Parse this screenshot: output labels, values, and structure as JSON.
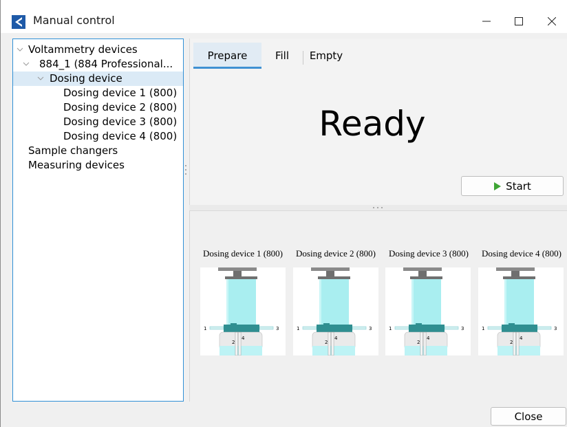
{
  "window": {
    "title": "Manual control",
    "icon": "app-logo-icon",
    "controls": [
      "minimize-icon",
      "maximize-icon",
      "close-icon"
    ]
  },
  "tree": {
    "root": {
      "label": "Voltammetry devices",
      "expanded": true
    },
    "instrument": {
      "label": "884_1 (884 Professional...",
      "expanded": true
    },
    "group": {
      "label": "Dosing device",
      "expanded": true,
      "selected": true
    },
    "devices": [
      "Dosing device 1 (800)",
      "Dosing device 2 (800)",
      "Dosing device 3 (800)",
      "Dosing device 4 (800)"
    ],
    "other": [
      "Sample changers",
      "Measuring devices"
    ]
  },
  "tabs": [
    {
      "label": "Prepare",
      "active": true
    },
    {
      "label": "Fill",
      "active": false
    },
    {
      "label": "Empty",
      "active": false
    }
  ],
  "status": "Ready",
  "start_button": {
    "label": "Start",
    "icon": "play-icon",
    "icon_color": "#3fa535"
  },
  "dosing_devices": [
    {
      "label": "Dosing device 1 (800)",
      "ports": [
        "1",
        "2",
        "3",
        "4"
      ]
    },
    {
      "label": "Dosing device 2 (800)",
      "ports": [
        "1",
        "2",
        "3",
        "4"
      ]
    },
    {
      "label": "Dosing device 3 (800)",
      "ports": [
        "1",
        "2",
        "3",
        "4"
      ]
    },
    {
      "label": "Dosing device 4 (800)",
      "ports": [
        "1",
        "2",
        "3",
        "4"
      ]
    }
  ],
  "close_button": {
    "label": "Close"
  },
  "colors": {
    "accent": "#2f8fd6",
    "selection": "#dbeaf6",
    "liquid": "#a9eef0",
    "piston": "#2f8f91"
  }
}
